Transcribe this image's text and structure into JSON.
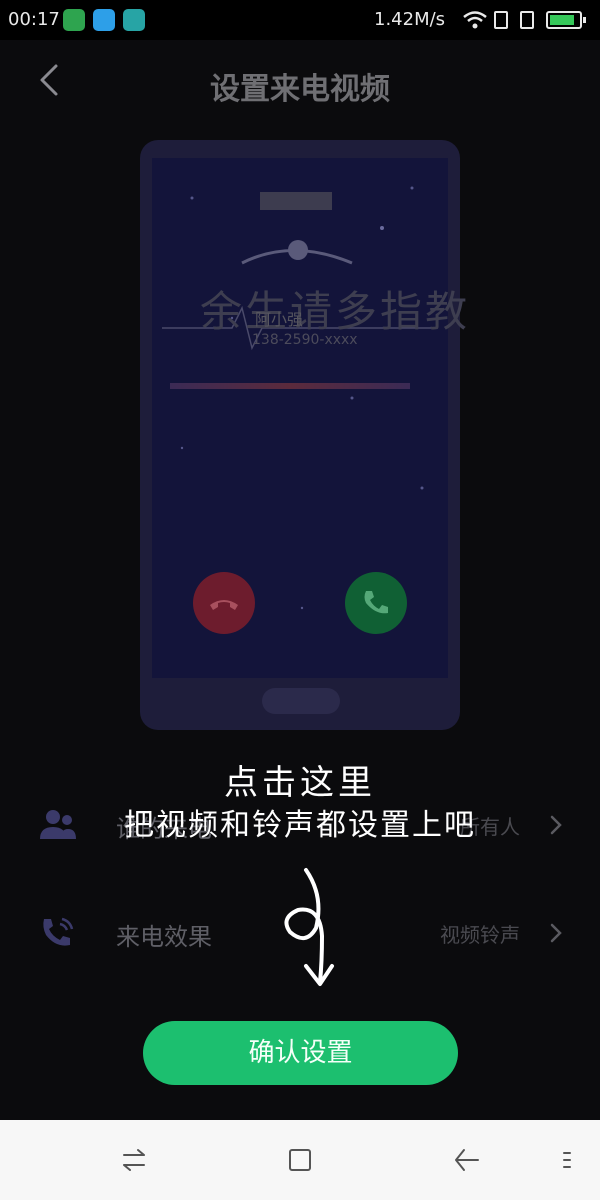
{
  "status_bar": {
    "time": "00:17",
    "speed": "1.42M/s"
  },
  "header": {
    "title": "设置来电视频"
  },
  "preview": {
    "caller_name": "阿小强",
    "caller_number": "138-2590-xxxx",
    "overlay_text": "余生请多指教"
  },
  "tips": {
    "line1": "点击这里",
    "line2": "把视频和铃声都设置上吧"
  },
  "settings": [
    {
      "label": "谁的来电",
      "value": "所有人"
    },
    {
      "label": "来电效果",
      "value": "视频铃声"
    }
  ],
  "confirm_button": "确认设置",
  "colors": {
    "accent": "#1cbf6f",
    "background": "#0b0b0d",
    "decline": "#6d1c2d",
    "accept": "#106034"
  },
  "icons": {
    "back": "chevron-left-icon",
    "people": "people-icon",
    "phone_ring": "phone-ring-icon",
    "chevron": "chevron-right-icon",
    "nav_switch": "switch-icon",
    "nav_home": "home-square-icon",
    "nav_back": "back-arrow-icon",
    "nav_menu": "menu-icon"
  }
}
